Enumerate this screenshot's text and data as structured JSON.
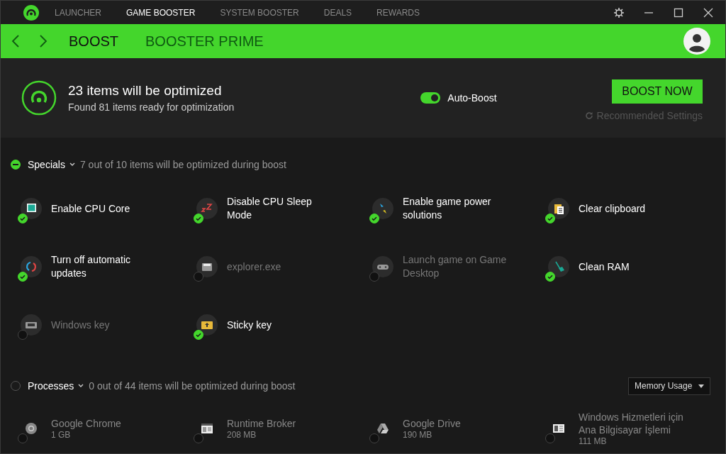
{
  "nav_tabs": [
    {
      "label": "LAUNCHER",
      "selected": false
    },
    {
      "label": "GAME BOOSTER",
      "selected": true
    },
    {
      "label": "SYSTEM BOOSTER",
      "selected": false
    },
    {
      "label": "DEALS",
      "selected": false
    },
    {
      "label": "REWARDS",
      "selected": false
    }
  ],
  "sub_tabs": [
    {
      "label": "BOOST",
      "selected": true
    },
    {
      "label": "BOOSTER PRIME",
      "selected": false
    }
  ],
  "summary": {
    "title": "23 items will be optimized",
    "subtitle": "Found 81 items ready for optimization",
    "auto_boost": {
      "label": "Auto-Boost",
      "on": true
    },
    "boost_button": "BOOST NOW",
    "recommended_link": "Recommended Settings"
  },
  "specials": {
    "title": "Specials",
    "partial": true,
    "caption": "7 out of 10 items will be optimized during boost",
    "items": [
      {
        "label": "Enable CPU Core",
        "checked": true
      },
      {
        "label": "Disable CPU Sleep Mode",
        "checked": true
      },
      {
        "label": "Enable game power solutions",
        "checked": true
      },
      {
        "label": "Clear clipboard",
        "checked": true
      },
      {
        "label": "Turn off automatic updates",
        "checked": true
      },
      {
        "label": "explorer.exe",
        "checked": false
      },
      {
        "label": "Launch game on Game Desktop",
        "checked": false
      },
      {
        "label": "Clean RAM",
        "checked": true
      },
      {
        "label": "Windows key",
        "checked": false
      },
      {
        "label": "Sticky key",
        "checked": true
      }
    ]
  },
  "processes": {
    "title": "Processes",
    "partial": false,
    "caption": "0 out of 44 items will be optimized during boost",
    "sort": "Memory Usage",
    "items": [
      {
        "label": "Google Chrome",
        "memory": "1 GB",
        "checked": false
      },
      {
        "label": "Runtime Broker",
        "memory": "208 MB",
        "checked": false
      },
      {
        "label": "Google Drive",
        "memory": "190 MB",
        "checked": false
      },
      {
        "label": "Windows Hizmetleri için Ana Bilgisayar İşlemi",
        "memory": "111 MB",
        "checked": false
      }
    ]
  }
}
